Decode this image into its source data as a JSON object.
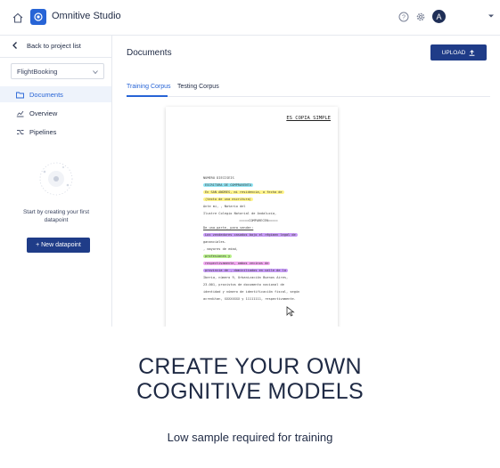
{
  "topbar": {
    "app_title": "Omnitive Studio",
    "avatar_initial": "A",
    "icons": [
      "home-icon",
      "app-logo-icon",
      "help-icon",
      "gear-icon",
      "caret-down-icon"
    ]
  },
  "sidebar": {
    "back_label": "Back to project list",
    "project_select": "FlightBooking",
    "items": [
      {
        "label": "Documents",
        "icon": "folder-icon",
        "active": true
      },
      {
        "label": "Overview",
        "icon": "chart-icon",
        "active": false
      },
      {
        "label": "Pipelines",
        "icon": "pipeline-icon",
        "active": false
      }
    ],
    "empty_text": "Start by creating your first datapoint",
    "new_button": "+ New datapoint"
  },
  "main": {
    "page_title": "Documents",
    "upload_label": "UPLOAD",
    "tabs": [
      {
        "label": "Training Corpus",
        "active": true
      },
      {
        "label": "Testing Corpus",
        "active": false
      }
    ],
    "document": {
      "header": "ES COPIA SIMPLE",
      "lines": [
        "NUMERO DIECISEIS",
        "ESCRITURA DE COMPRAVENTA",
        "En SAN ANDRES, mi residencia, a fecha de",
        "(texto de una escritura)",
        "Ante mi,                 , Notario del",
        "Ilustre Colegio Notarial de Andalucía,",
        "=====COMPARECEN=====",
        "De una parte, para vender:",
        "Los vendedores casados bajo el régimen legal de",
        "gananciales.",
        "                    , mayores de edad,",
        "profesiones              y",
        "respectivamente, ambos vecinos de",
        "provincia de     , domiciliados en calle de la",
        "Iberia, número 9, Urbanización Buenos Aires,",
        "23.001, provistos de documento nacional de",
        "identidad y número de identificación fiscal, según",
        "acreditan, XXXXXXXX y 11111111, respectivamente."
      ]
    }
  },
  "headline": {
    "line1": "CREATE YOUR OWN",
    "line2": "COGNITIVE MODELS"
  },
  "subline": "Low sample required for training",
  "colors": {
    "primary": "#1f3c88",
    "accent": "#2764d6",
    "highlight_cyan": "#8fe3f2",
    "highlight_yellow": "#fff48a",
    "highlight_green": "#b8f08a",
    "highlight_pink": "#f2a8f0",
    "highlight_purple": "#c79bf7"
  }
}
